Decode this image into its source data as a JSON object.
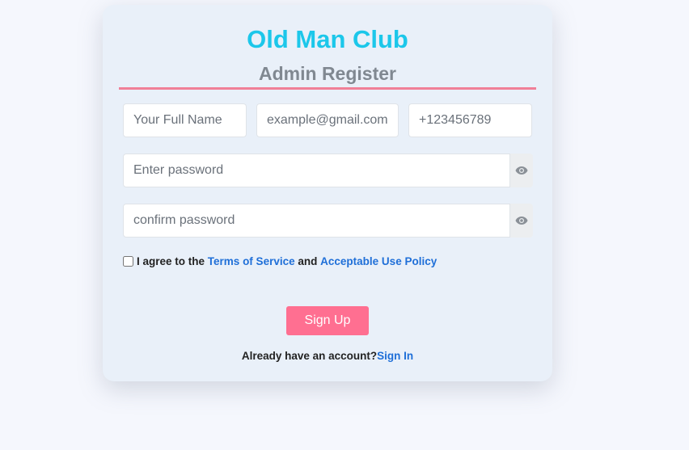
{
  "form": {
    "title": "Old Man Club",
    "subtitle": "Admin Register",
    "name_placeholder": "Your Full Name",
    "email_placeholder": "example@gmail.com",
    "phone_placeholder": "+123456789",
    "password_placeholder": "Enter password",
    "confirm_placeholder": "confirm password",
    "password_toggle_icon": "eye-icon",
    "terms_prefix": "I agree to the",
    "terms_link": "Terms of Service",
    "terms_and": "and",
    "policy_link": "Acceptable Use Policy",
    "submit_label": "Sign Up",
    "signin_prompt": "Already have an account?",
    "signin_link": "Sign In"
  },
  "colors": {
    "title": "#1cc7ea",
    "subtitle": "#808891",
    "divider": "#f07f97",
    "button": "#ff6f91",
    "link": "#1f6fd8",
    "card": "#e9f0f9",
    "page": "#f5f7fd"
  }
}
